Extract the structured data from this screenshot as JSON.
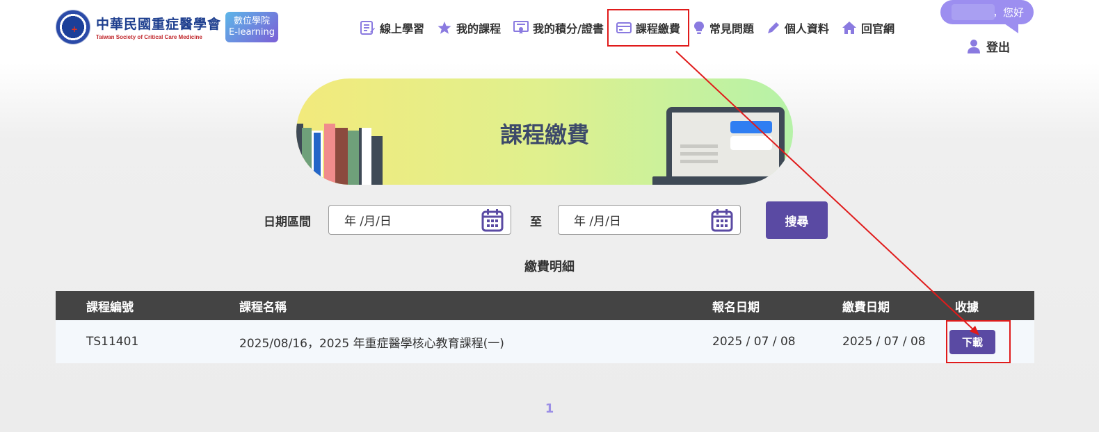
{
  "header": {
    "logo_zh": "中華民國重症醫學會",
    "logo_en": "Taiwan Society of Critical Care Medicine",
    "badge_line1": "數位學院",
    "badge_line2": "E-learning",
    "nav": [
      {
        "label": "線上學習",
        "icon": "edit-list-icon"
      },
      {
        "label": "我的課程",
        "icon": "star-icon"
      },
      {
        "label": "我的積分/證書",
        "icon": "certificate-icon"
      },
      {
        "label": "課程繳費",
        "icon": "credit-card-icon",
        "active": true
      },
      {
        "label": "常見問題",
        "icon": "lightbulb-icon"
      },
      {
        "label": "個人資料",
        "icon": "pencil-icon"
      },
      {
        "label": "回官網",
        "icon": "home-icon"
      }
    ],
    "greeting": "，您好",
    "logout": "登出"
  },
  "banner": {
    "title": "課程繳費"
  },
  "search": {
    "date_label": "日期區間",
    "start_placeholder": "年 /月/日",
    "to_label": "至",
    "end_placeholder": "年 /月/日",
    "button": "搜尋"
  },
  "section_title": "繳費明細",
  "table": {
    "headers": [
      "課程編號",
      "課程名稱",
      "報名日期",
      "繳費日期",
      "收據"
    ],
    "rows": [
      {
        "course_id": "TS11401",
        "course_name": "2025/08/16，2025 年重症醫學核心教育課程(一)",
        "register_date": "2025 / 07 / 08",
        "pay_date": "2025 / 07 / 08",
        "receipt_button": "下載"
      }
    ]
  },
  "pagination": {
    "current": "1"
  },
  "colors": {
    "primary": "#5a4aa3",
    "accent": "#9c8ef0",
    "highlight": "#e01b1b"
  }
}
